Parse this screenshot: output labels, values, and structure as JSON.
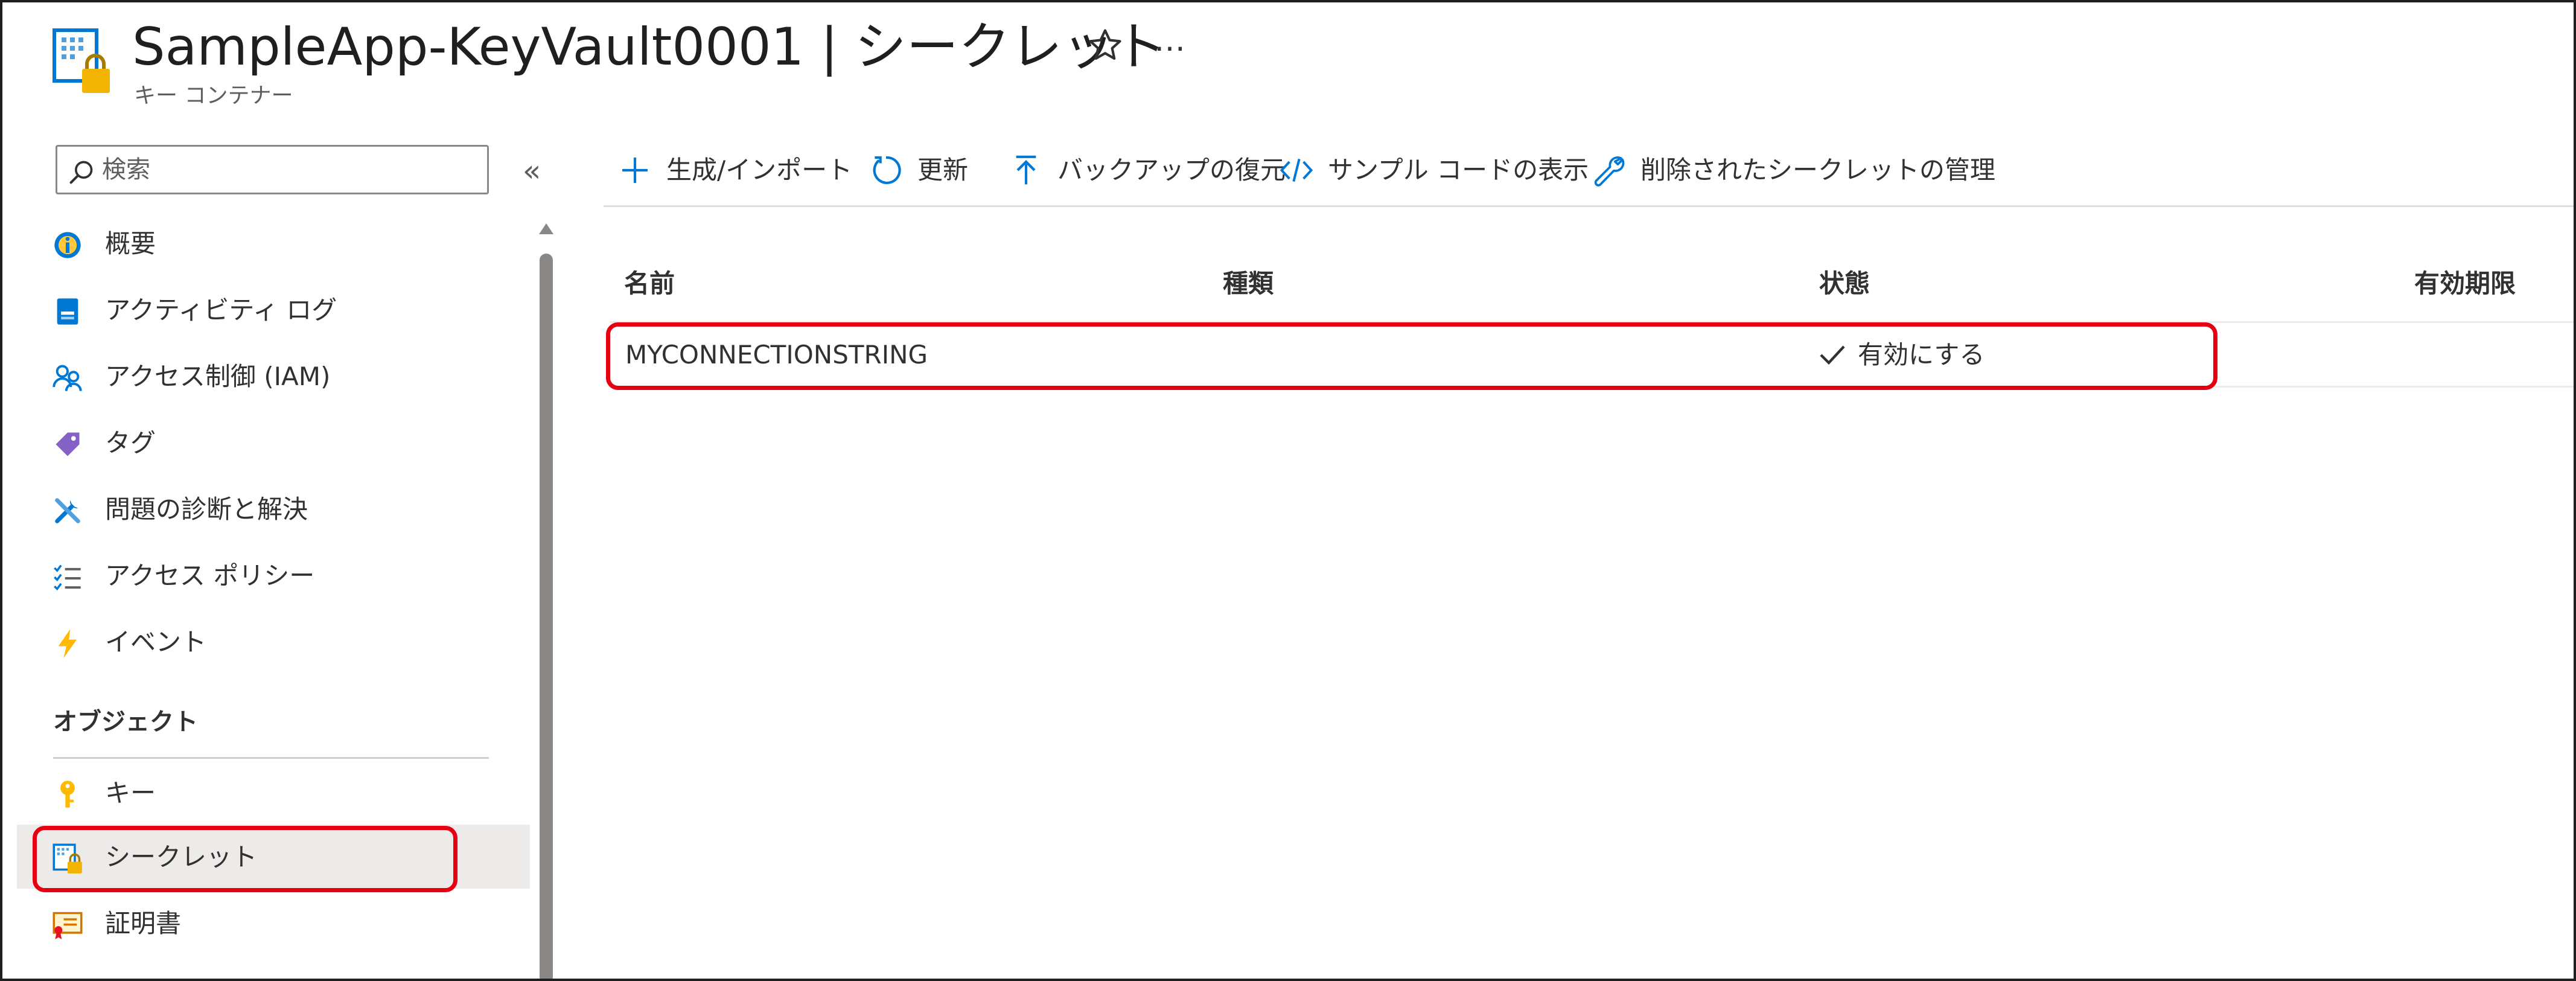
{
  "header": {
    "title": "SampleApp-KeyVault0001 | シークレット",
    "subtitle": "キー コンテナー",
    "more_label": "…"
  },
  "nav": {
    "search_placeholder": "検索",
    "collapse_label": "«",
    "items": [
      {
        "label": "概要",
        "icon": "overview-icon"
      },
      {
        "label": "アクティビティ ログ",
        "icon": "activity-log-icon"
      },
      {
        "label": "アクセス制御 (IAM)",
        "icon": "access-control-icon"
      },
      {
        "label": "タグ",
        "icon": "tag-icon"
      },
      {
        "label": "問題の診断と解決",
        "icon": "diagnose-icon"
      },
      {
        "label": "アクセス ポリシー",
        "icon": "access-policy-icon"
      },
      {
        "label": "イベント",
        "icon": "event-icon"
      }
    ],
    "section_header": "オブジェクト",
    "object_items": [
      {
        "label": "キー",
        "icon": "key-icon"
      },
      {
        "label": "シークレット",
        "icon": "secret-icon",
        "selected": true
      },
      {
        "label": "証明書",
        "icon": "certificate-icon"
      }
    ]
  },
  "commands": [
    {
      "label": "生成/インポート",
      "icon": "plus-icon"
    },
    {
      "label": "更新",
      "icon": "refresh-icon"
    },
    {
      "label": "バックアップの復元",
      "icon": "upload-icon"
    },
    {
      "label": "サンプル コードの表示",
      "icon": "code-icon"
    },
    {
      "label": "削除されたシークレットの管理",
      "icon": "wrench-icon"
    }
  ],
  "table": {
    "columns": [
      "名前",
      "種類",
      "状態",
      "有効期限"
    ],
    "rows": [
      {
        "name": "MYCONNECTIONSTRING",
        "type": "",
        "status": "有効にする",
        "expires": ""
      }
    ]
  },
  "colors": {
    "accent": "#0078d4",
    "highlight": "#e60012",
    "selected_bg": "#edebe9"
  }
}
